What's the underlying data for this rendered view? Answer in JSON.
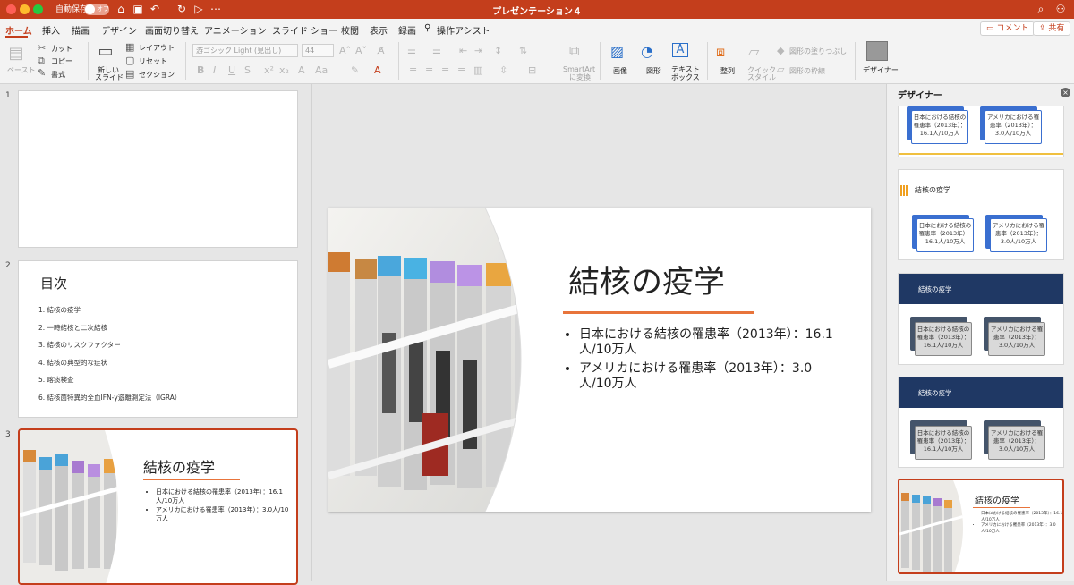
{
  "app": {
    "autosave_label": "自動保存",
    "autosave_state": "オフ",
    "document_title": "プレゼンテーション４"
  },
  "tabs": [
    "ホーム",
    "挿入",
    "描画",
    "デザイン",
    "画面切り替え",
    "アニメーション",
    "スライド ショー",
    "校閲",
    "表示",
    "録画",
    "操作アシスト"
  ],
  "header_buttons": {
    "comment": "コメント",
    "share": "共有"
  },
  "ribbon": {
    "paste": "ペースト",
    "cut": "カット",
    "copy": "コピー",
    "format": "書式",
    "new_slide_1": "新しい",
    "new_slide_2": "スライド",
    "layout": "レイアウト",
    "reset": "リセット",
    "section": "セクション",
    "font_name": "游ゴシック Light (見出し)",
    "font_size": "44",
    "smartart_1": "SmartArt",
    "smartart_2": "に変換",
    "image": "画像",
    "shape": "図形",
    "textbox_1": "テキスト",
    "textbox_2": "ボックス",
    "arrange": "整列",
    "quickstyle_1": "クイック",
    "quickstyle_2": "スタイル",
    "shape_fill": "図形の塗りつぶし",
    "shape_outline": "図形の枠線",
    "designer": "デザイナー"
  },
  "thumbnails": [
    {
      "num": "1"
    },
    {
      "num": "2",
      "title": "目次",
      "items": [
        "1.   結核の疫学",
        "2.   一時結核と二次結核",
        "3.   結核のリスクファクター",
        "4.   結核の典型的な症状",
        "5.   喀痰検査",
        "6.   結核菌特異的全血IFN-γ遊離測定法（IGRA）"
      ]
    },
    {
      "num": "3"
    }
  ],
  "slide": {
    "title": "結核の疫学",
    "bullets": [
      "日本における結核の罹患率（2013年）：16.1人/10万人",
      "アメリカにおける罹患率（2013年）：3.0人/10万人"
    ],
    "accent_color": "#e8743b"
  },
  "designer": {
    "title": "デザイナー",
    "box1": "日本における結核の罹患率（2013年）：16.1人/10万人",
    "box2": "アメリカにおける罹患率（2013年）：3.0人/10万人",
    "card_title": "結核の疫学"
  },
  "colors": {
    "brand": "#c43e1c",
    "navy": "#1f3864",
    "blue": "#3a6fd0"
  }
}
